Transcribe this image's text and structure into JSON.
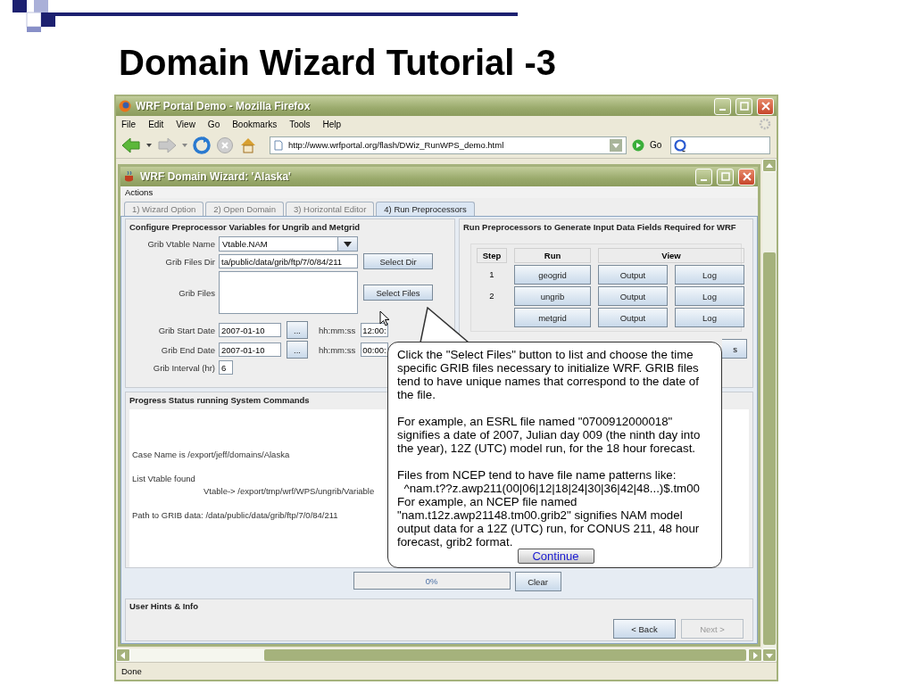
{
  "slide": {
    "title": "Domain Wizard Tutorial -3"
  },
  "browser": {
    "title": "WRF Portal Demo - Mozilla Firefox",
    "menu": [
      "File",
      "Edit",
      "View",
      "Go",
      "Bookmarks",
      "Tools",
      "Help"
    ],
    "url": "http://www.wrfportal.org/flash/DWiz_RunWPS_demo.html",
    "go": "Go",
    "status": "Done"
  },
  "wizard": {
    "title": "WRF Domain Wizard: 'Alaska'",
    "menu": [
      "Actions"
    ],
    "tabs": [
      {
        "label": "1) Wizard Option",
        "selected": false
      },
      {
        "label": "2) Open Domain",
        "selected": false
      },
      {
        "label": "3) Horizontal Editor",
        "selected": false
      },
      {
        "label": "4) Run Preprocessors",
        "selected": true
      }
    ],
    "config": {
      "title": "Configure Preprocessor Variables for Ungrib and Metgrid",
      "vtable_label": "Grib Vtable Name",
      "vtable_value": "Vtable.NAM",
      "dir_label": "Grib Files Dir",
      "dir_value": "ta/public/data/grib/ftp/7/0/84/211",
      "select_dir": "Select Dir",
      "files_label": "Grib Files",
      "select_files": "Select Files",
      "start_label": "Grib Start Date",
      "start_value": "2007-01-10",
      "start_pick": "...",
      "start_time_label": "hh:mm:ss",
      "start_time": "12:00:",
      "end_label": "Grib End Date",
      "end_value": "2007-01-10",
      "end_pick": "...",
      "end_time_label": "hh:mm:ss",
      "end_time": "00:00:",
      "interval_label": "Grib Interval (hr)",
      "interval_value": "6"
    },
    "run": {
      "title": "Run Preprocessors to Generate Input Data Fields Required for WRF",
      "columns": [
        "Step",
        "Run",
        "View"
      ],
      "rows": [
        {
          "step": "1",
          "run": "geogrid",
          "output": "Output",
          "log": "Log"
        },
        {
          "step": "2",
          "run": "ungrib",
          "output": "Output",
          "log": "Log"
        },
        {
          "run": "metgrid",
          "output": "Output",
          "log": "Log"
        }
      ],
      "extra_button": "s"
    },
    "progress": {
      "title": "Progress Status running System Commands",
      "lines": [
        {
          "text": "Case Name is /export/jeff/domains/Alaska"
        },
        {
          "text": "List Vtable found",
          "children": [
            {
              "text": "Vtable-> /export/tmp/wrf/WPS/ungrib/Variable"
            }
          ]
        },
        {
          "text": "Path to GRIB data: /data/public/data/grib/ftp/7/0/84/211"
        }
      ],
      "percent": "0%",
      "level": 0,
      "clear": "Clear"
    },
    "hints": {
      "title": "User Hints & Info",
      "back": "<  Back",
      "next": "Next  >",
      "next_disabled": true
    }
  },
  "callout": {
    "paragraphs": [
      [
        "Click the \"Select Files\" button to list and choose the time specific GRIB files necessary to initialize WRF. GRIB files tend to have unique names that correspond to the date of the file."
      ],
      [
        "For example, an ESRL file named \"0700912000018\" signifies a date of 2007, Julian day 009 (the ninth day into the year), 12Z (UTC) model run, for the 18 hour forecast."
      ],
      [
        "Files from NCEP tend to have file name patterns like:",
        "  ^nam.t??z.awp211(00|06|12|18|24|30|36|42|48...)$.tm00",
        "For example, an NCEP file named \"nam.t12z.awp21148.tm00.grib2\" signifies NAM model output data for a 12Z (UTC) run, for CONUS 211, 48 hour forecast, grib2 format."
      ]
    ],
    "button": "Continue"
  }
}
